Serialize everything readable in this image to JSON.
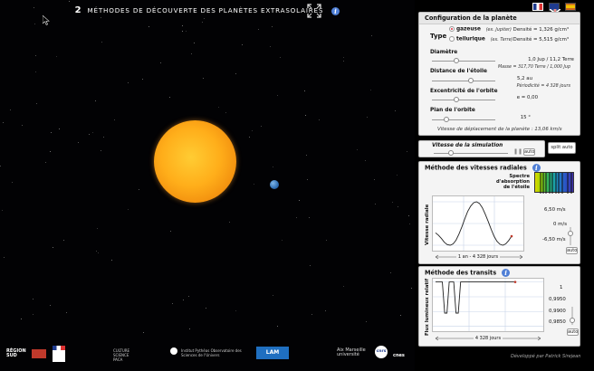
{
  "header": {
    "title_number": "2",
    "title_text": "MÉTHODES DE DÉCOUVERTE DES PLANÈTES EXTRASOLAIRES",
    "info_glyph": "i"
  },
  "config": {
    "header": "Configuration de la planète",
    "type_label": "Type",
    "gas_label": "gazeuse",
    "gas_example": "(ex. Jupiter)",
    "gas_density": "Densité = 1,326 g/cm³",
    "rock_label": "tellurique",
    "rock_example": "(ex. Terre)",
    "rock_density": "Densité = 5,515 g/cm³",
    "diameter_label": "Diamètre",
    "diameter_value": "1,0 Jup / 11,2 Terre",
    "distance_label": "Distance de l'étoile",
    "mass_info": "Masse = 317,70 Terre / 1,000 Jup",
    "distance_value": "5,2 au",
    "period_info": "Périodicité = 4 328 jours",
    "eccentricity_label": "Excentricité de l'orbite",
    "eccentricity_value": "e = 0,00",
    "orbit_plane_label": "Plan de l'orbite",
    "orbit_plane_value": "15 °",
    "speed_info": "Vitesse de déplacement de la planète : 13,06 km/s",
    "selected_type": "gazeuse"
  },
  "simulation": {
    "speed_label": "Vitesse de la simulation",
    "auto_label": "auto",
    "split_label": "split auto"
  },
  "radial": {
    "header": "Méthode des vitesses radiales",
    "spectrum_label": "Spectre d'absorption de l'étoile",
    "ylabel": "Vitesse radiale",
    "tick_top": "6,50 m/s",
    "tick_mid": "0 m/s",
    "tick_bottom": "-6,50 m/s",
    "xscale": "1 an - 4 328 jours",
    "auto_label": "auto",
    "chart_data": {
      "type": "line",
      "ylabel": "Vitesse radiale",
      "ylim": [
        -6.5,
        6.5
      ],
      "y_ticks": [
        "6,50 m/s",
        "0 m/s",
        "-6,50 m/s"
      ],
      "x_scale_label": "1 an - 4 328 jours",
      "series": [
        {
          "values": [
            -2.8,
            -3.5,
            -4.5,
            -5.6,
            -6.3,
            -6.5,
            -6.1,
            -5.0,
            -3.2,
            -1.0,
            1.4,
            3.6,
            5.2,
            6.2,
            6.5,
            6.0,
            4.7,
            2.8,
            0.6,
            -1.7,
            -3.8,
            -5.3,
            -6.2,
            -6.5,
            -6.1,
            -5.1,
            -3.8
          ]
        }
      ]
    }
  },
  "transit": {
    "header": "Méthode des transits",
    "ylabel": "Flux lumineux relatif",
    "tick_1": "1",
    "tick_2": "0,9950",
    "tick_3": "0,9900",
    "tick_4": "0,9850",
    "xscale": "4 328 jours",
    "auto_label": "auto",
    "chart_data": {
      "type": "line",
      "ylabel": "Flux lumineux relatif",
      "ylim": [
        0.984,
        1.0005
      ],
      "y_ticks": [
        "1",
        "0,9950",
        "0,9900",
        "0,9850"
      ],
      "x_scale_label": "4 328 jours",
      "series": [
        {
          "values": [
            1,
            1,
            1,
            1,
            0.9895,
            0.9895,
            1,
            1,
            1,
            0.9895,
            0.9895,
            1,
            1,
            1,
            1,
            1,
            1,
            1,
            1,
            1,
            1,
            1,
            1,
            1,
            1,
            1,
            1,
            1,
            1,
            1,
            1,
            1,
            1,
            1,
            1,
            1
          ]
        }
      ]
    }
  },
  "footer": {
    "credit": "Développé par Patrick Sirejean",
    "logo_region": "RÉGION SUD",
    "logo_culture": "CULTURE SCIENCE PACA",
    "logo_pytheas": "Institut Pythéas Observatoire des Sciences de l'Univers",
    "logo_lam": "LAM",
    "logo_amu": "Aix Marseille université",
    "logo_cnrs": "cnrs",
    "logo_cnes": "cnes"
  },
  "colors": {
    "sun": "#ffae1a",
    "planet": "#2f6fb5",
    "panel_bg": "#f4f4f4",
    "info_blue": "#4f7fd6",
    "curve": "#222222",
    "marker": "#c0392b"
  }
}
